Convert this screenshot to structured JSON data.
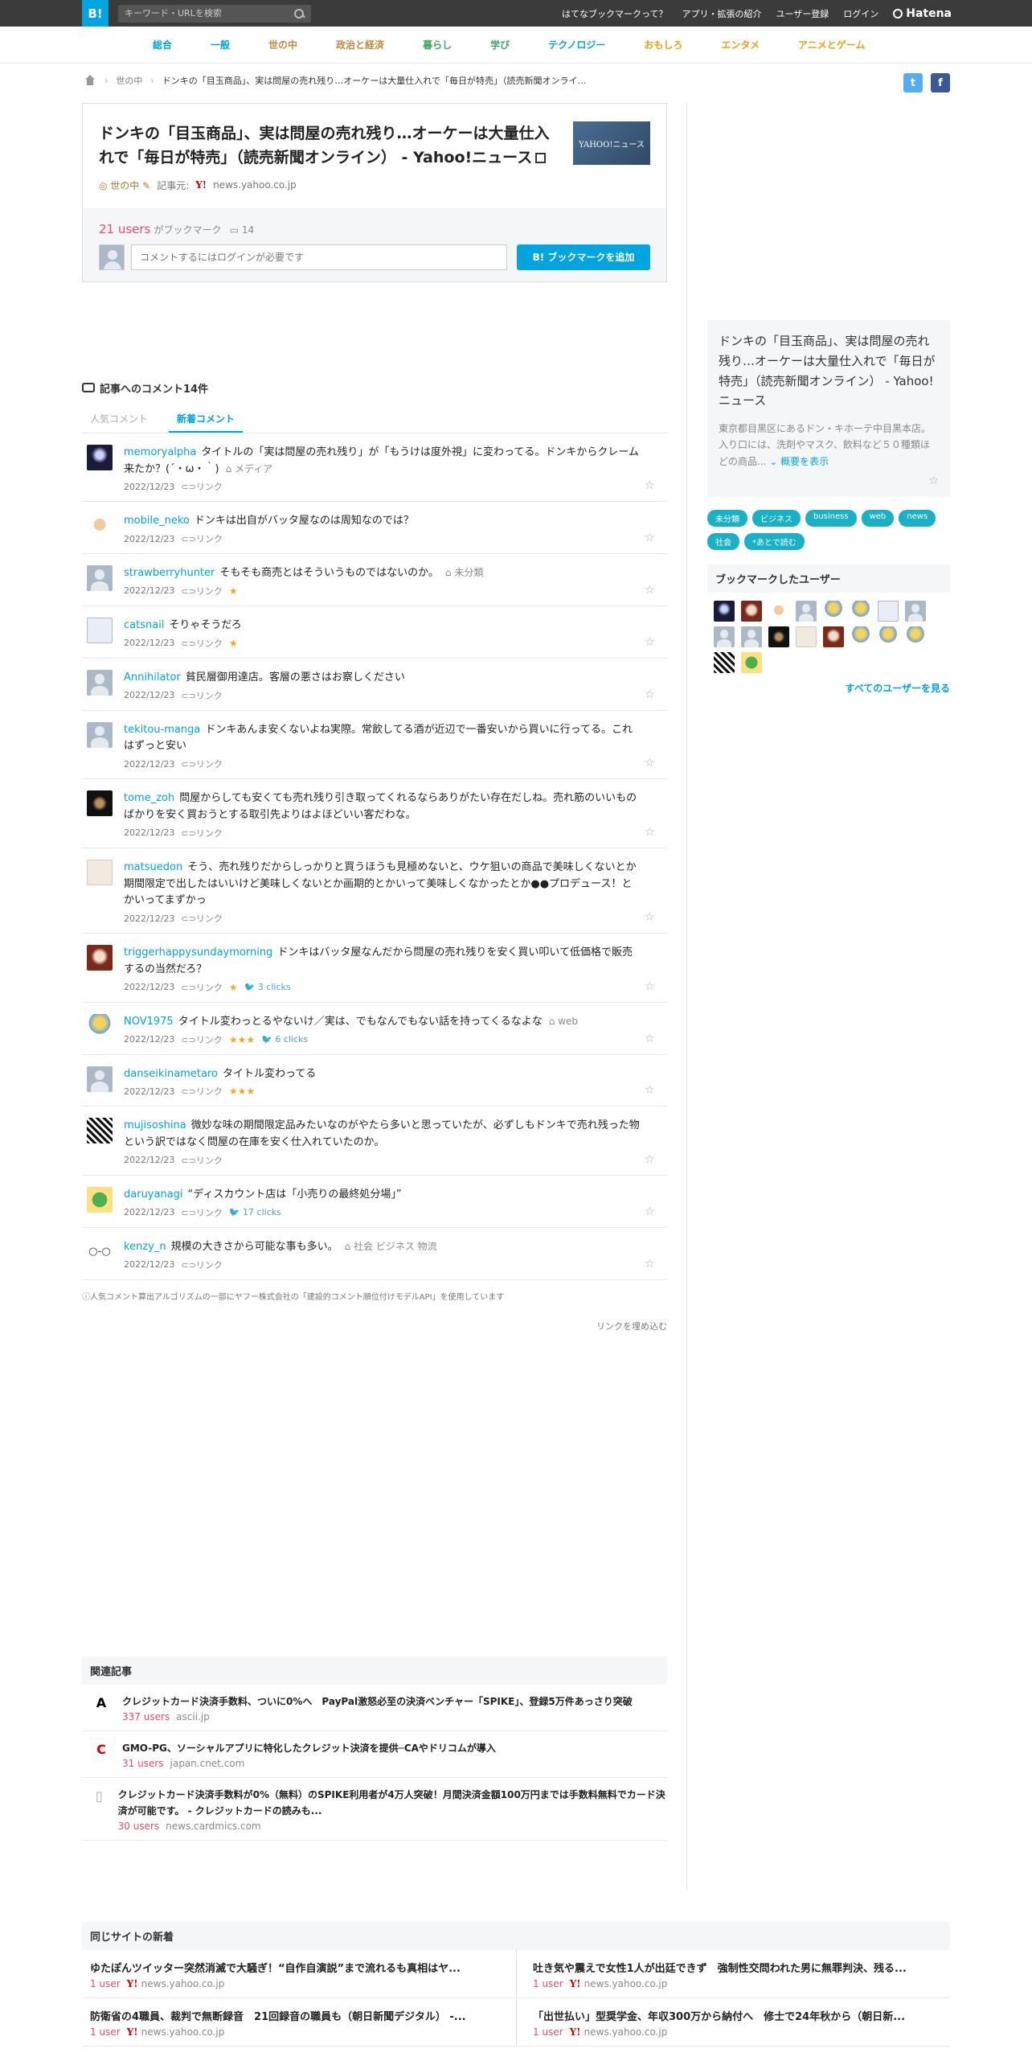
{
  "topbar": {
    "logo": "B!",
    "search_placeholder": "キーワード・URLを検索",
    "nav": [
      "はてなブックマークって？",
      "アプリ・拡張の紹介",
      "ユーザー登録",
      "ログイン"
    ],
    "hatena": "Hatena"
  },
  "categories": [
    {
      "label": "総合",
      "color": "#00a4de"
    },
    {
      "label": "一般",
      "color": "#00a4de"
    },
    {
      "label": "世の中",
      "color": "#c08a3e"
    },
    {
      "label": "政治と経済",
      "color": "#c08a3e"
    },
    {
      "label": "暮らし",
      "color": "#3ca55c"
    },
    {
      "label": "学び",
      "color": "#3ca55c"
    },
    {
      "label": "テクノロジー",
      "color": "#00a4de"
    },
    {
      "label": "おもしろ",
      "color": "#e8a317"
    },
    {
      "label": "エンタメ",
      "color": "#e8a317"
    },
    {
      "label": "アニメとゲーム",
      "color": "#e8a317"
    }
  ],
  "breadcrumb": {
    "section": "世の中",
    "current": "ドンキの「目玉商品」、実は問屋の売れ残り…オーケーは大量仕入れで「毎日が特売」（読売新聞オンライ…"
  },
  "entry": {
    "title": "ドンキの「目玉商品」、実は問屋の売れ残り…オーケーは大量仕入れで「毎日が特売」（読売新聞オンライン） - Yahoo!ニュース",
    "thumbnail_text": "YAHOO!ニュース",
    "category": "世の中",
    "source_label": "記事元:",
    "source": "news.yahoo.co.jp",
    "users": "21 users",
    "users_suffix": "がブックマーク",
    "comments": "14",
    "comment_placeholder": "コメントするにはログインが必要です",
    "add_button": "B! ブックマークを追加"
  },
  "comments_section": {
    "heading": "記事へのコメント14件",
    "tabs": [
      "人気コメント",
      "新着コメント"
    ],
    "link_label": "リンク",
    "items": [
      {
        "user": "memoryalpha",
        "text": "タイトルの「実は問屋の売れ残り」が「もうけは度外視」に変わってる。ドンキからクレーム来たか？(´・ω・｀)",
        "tags": "メディア",
        "date": "2022/12/23",
        "stars": "",
        "clicks": "",
        "avatar": "av-dark"
      },
      {
        "user": "mobile_neko",
        "text": "ドンキは出自がバッタ屋なのは周知なのでは？",
        "tags": "",
        "date": "2022/12/23",
        "stars": "",
        "clicks": "",
        "avatar": "av-face"
      },
      {
        "user": "strawberryhunter",
        "text": "そもそも商売とはそういうものではないのか。",
        "tags": "未分類",
        "date": "2022/12/23",
        "stars": "★",
        "clicks": "",
        "avatar": "av-generic"
      },
      {
        "user": "catsnail",
        "text": "そりゃそうだろ",
        "tags": "",
        "date": "2022/12/23",
        "stars": "★",
        "clicks": "",
        "avatar": "av-white"
      },
      {
        "user": "Annihilator",
        "text": "貧民層御用達店。客層の悪さはお察しください",
        "tags": "",
        "date": "2022/12/23",
        "stars": "",
        "clicks": "",
        "avatar": "av-generic"
      },
      {
        "user": "tekitou-manga",
        "text": "ドンキあんま安くないよね実際。常飲してる酒が近辺で一番安いから買いに行ってる。これはずっと安い",
        "tags": "",
        "date": "2022/12/23",
        "stars": "",
        "clicks": "",
        "avatar": "av-generic"
      },
      {
        "user": "tome_zoh",
        "text": "問屋からしても安くても売れ残り引き取ってくれるならありがたい存在だしね。売れ筋のいいものばかりを安く買おうとする取引先よりはよほどいい客だわな。",
        "tags": "",
        "date": "2022/12/23",
        "stars": "",
        "clicks": "",
        "avatar": "av-black"
      },
      {
        "user": "matsuedon",
        "text": "そう、売れ残りだからしっかりと買うほうも見極めないと、ウケ狙いの商品で美味しくないとか期間限定で出したはいいけど美味しくないとか画期的とかいって美味しくなかったとか●●プロデュース！とかいってまずかっ",
        "tags": "",
        "date": "2022/12/23",
        "stars": "",
        "clicks": "",
        "avatar": "av-sketch"
      },
      {
        "user": "triggerhappysundaymorning",
        "text": "ドンキはバッタ屋なんだから問屋の売れ残りを安く買い叩いて低価格で販売するの当然だろ？",
        "tags": "",
        "date": "2022/12/23",
        "stars": "★",
        "clicks": "3 clicks",
        "avatar": "av-red"
      },
      {
        "user": "NOV1975",
        "text": "タイトル変わっとるやないけ／実は、でもなんでもない話を持ってくるなよな",
        "tags": "web",
        "date": "2022/12/23",
        "stars": "★★★",
        "clicks": "6 clicks",
        "avatar": "av-yellow"
      },
      {
        "user": "danseikinametaro",
        "text": "タイトル変わってる",
        "tags": "",
        "date": "2022/12/23",
        "stars": "★★★",
        "clicks": "",
        "avatar": "av-generic"
      },
      {
        "user": "mujisoshina",
        "text": "微妙な味の期間限定品みたいなのがやたら多いと思っていたが、必ずしもドンキで売れ残った物という訳ではなく問屋の在庫を安く仕入れていたのか。",
        "tags": "",
        "date": "2022/12/23",
        "stars": "",
        "clicks": "",
        "avatar": "av-bw"
      },
      {
        "user": "daruyanagi",
        "text": "“ディスカウント店は「小売りの最終処分場」”",
        "tags": "",
        "date": "2022/12/23",
        "stars": "",
        "clicks": "17 clicks",
        "avatar": "av-green"
      },
      {
        "user": "kenzy_n",
        "text": "規模の大きさから可能な事も多い。",
        "tags": "社会  ビジネス  物流",
        "date": "2022/12/23",
        "stars": "",
        "clicks": "",
        "avatar": "av-glasses"
      }
    ],
    "algo_note": "ⓘ人気コメント算出アルゴリズムの一部にヤフー株式会社の「建設的コメント順位付けモデルAPI」を使用しています",
    "embed_link": "リンクを埋め込む"
  },
  "sidebar": {
    "summary_title": "ドンキの「目玉商品」、実は問屋の売れ残り…オーケーは大量仕入れで「毎日が特売」（読売新聞オンライン） - Yahoo!ニュース",
    "summary_text": "東京都目黒区にあるドン・キホーテ中目黒本店。入り口には、洗剤やマスク、飲料など５０種類ほどの商品...",
    "summary_more": "概要を表示",
    "tags": [
      "未分類",
      "ビジネス",
      "business",
      "web",
      "news",
      "社会",
      "*あとで読む"
    ],
    "users_heading": "ブックマークしたユーザー",
    "user_avatars": [
      "av-dark",
      "av-red",
      "av-face",
      "av-generic",
      "av-yellow",
      "av-yellow",
      "av-white",
      "av-generic",
      "av-generic",
      "av-generic",
      "av-black",
      "av-sketch",
      "av-red",
      "av-yellow",
      "av-yellow",
      "av-yellow",
      "av-bw",
      "av-green"
    ],
    "see_all": "すべてのユーザーを見る"
  },
  "related": {
    "heading": "関連記事",
    "items": [
      {
        "icon": "A",
        "icon_color": "#000",
        "title": "クレジットカード決済手数料、ついに0%へ　PayPal激怒必至の決済ベンチャー「SPIKE」、登録5万件あっさり突破",
        "users": "337 users",
        "source": "ascii.jp"
      },
      {
        "icon": "C",
        "icon_color": "#d10000",
        "title": "GMO-PG、ソーシャルアプリに特化したクレジット決済を提供─CAやドリコムが導入",
        "users": "31 users",
        "source": "japan.cnet.com"
      },
      {
        "icon": "▯",
        "icon_color": "#aaa",
        "title": "クレジットカード決済手数料が0%（無料）のSPIKE利用者が4万人突破！月間決済金額100万円までは手数料無料でカード決済が可能です。 - クレジットカードの読みも...",
        "users": "30 users",
        "source": "news.cardmics.com"
      }
    ]
  },
  "samesite": {
    "heading": "同じサイトの新着",
    "items": [
      {
        "title": "ゆたぽんツイッター突然消滅で大騒ぎ！“自作自演説”まで流れるも真相はヤ...",
        "users": "1 user",
        "source": "news.yahoo.co.jp"
      },
      {
        "title": "吐き気や震えで女性1人が出廷できず　強制性交問われた男に無罪判決、残る...",
        "users": "1 user",
        "source": "news.yahoo.co.jp"
      },
      {
        "title": "防衛省の4職員、裁判で無断録音　21回録音の職員も（朝日新聞デジタル） -...",
        "users": "1 user",
        "source": "news.yahoo.co.jp"
      },
      {
        "title": "「出世払い」型奨学金、年収300万から納付へ　修士で24年秋から（朝日新...",
        "users": "1 user",
        "source": "news.yahoo.co.jp"
      }
    ]
  }
}
